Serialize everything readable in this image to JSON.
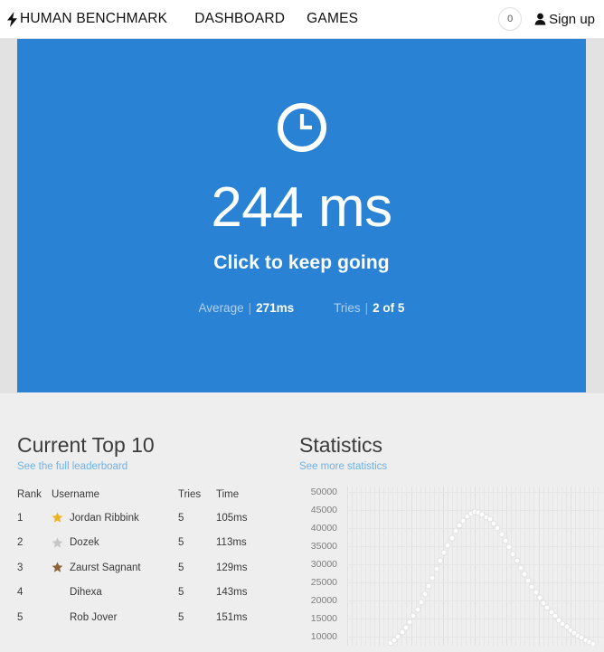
{
  "navbar": {
    "brand": "HUMAN BENCHMARK",
    "brand_icon": "bolt-icon",
    "links": [
      {
        "label": "DASHBOARD",
        "name": "nav-link-dashboard"
      },
      {
        "label": "GAMES",
        "name": "nav-link-games"
      }
    ],
    "token_count": "0",
    "signup_label": "Sign up",
    "signup_icon": "user-icon"
  },
  "test_panel": {
    "icon": "clock-icon",
    "time": "244 ms",
    "subtitle": "Click to keep going",
    "stats": [
      {
        "label": "Average",
        "separator": "|",
        "value": "271ms"
      },
      {
        "label": "Tries",
        "separator": "|",
        "value": "2 of 5"
      }
    ],
    "background_color": "#2a82d4"
  },
  "leaderboard": {
    "title": "Current Top 10",
    "link": "See the full leaderboard",
    "columns": [
      "Rank",
      "Username",
      "Tries",
      "Time"
    ],
    "rows": [
      {
        "rank": "1",
        "medal": "gold",
        "medal_color": "#e8b425",
        "username": "Jordan Ribbink",
        "tries": "5",
        "time": "105ms"
      },
      {
        "rank": "2",
        "medal": "silver",
        "medal_color": "#c6c6c6",
        "username": "Dozek",
        "tries": "5",
        "time": "113ms"
      },
      {
        "rank": "3",
        "medal": "bronze",
        "medal_color": "#8c6239",
        "username": "Zaurst Sagnant",
        "tries": "5",
        "time": "129ms"
      },
      {
        "rank": "4",
        "medal": "none",
        "medal_color": "",
        "username": "Dihexa",
        "tries": "5",
        "time": "143ms"
      },
      {
        "rank": "5",
        "medal": "none",
        "medal_color": "",
        "username": "Rob Jover",
        "tries": "5",
        "time": "151ms"
      }
    ]
  },
  "statistics": {
    "title": "Statistics",
    "link": "See more statistics"
  },
  "chart_data": {
    "type": "scatter",
    "title": "Statistics",
    "xlabel": "",
    "ylabel": "",
    "grid": true,
    "legend": null,
    "ylim": [
      7500,
      51500
    ],
    "yticks": [
      50000,
      45000,
      40000,
      35000,
      30000,
      25000,
      20000,
      15000,
      10000
    ],
    "ytick_labels": [
      "50000",
      "45000",
      "40000",
      "35000",
      "30000",
      "25000",
      "20000",
      "15000",
      "10000"
    ],
    "xlim": [
      0,
      100
    ],
    "note": "reaction-time distribution; counts of users per reaction time bucket",
    "points": [
      [
        17.0,
        8200
      ],
      [
        18.5,
        9000
      ],
      [
        20.0,
        10100
      ],
      [
        21.5,
        11300
      ],
      [
        23.0,
        12600
      ],
      [
        24.5,
        14100
      ],
      [
        26.0,
        15800
      ],
      [
        27.5,
        17600
      ],
      [
        29.0,
        19600
      ],
      [
        30.5,
        21700
      ],
      [
        32.0,
        24000
      ],
      [
        33.5,
        26300
      ],
      [
        35.0,
        28700
      ],
      [
        36.5,
        31000
      ],
      [
        38.0,
        33300
      ],
      [
        39.5,
        35400
      ],
      [
        41.0,
        37400
      ],
      [
        42.5,
        39200
      ],
      [
        44.0,
        40800
      ],
      [
        45.5,
        42100
      ],
      [
        47.0,
        43200
      ],
      [
        48.5,
        44000
      ],
      [
        50.0,
        44500
      ],
      [
        51.5,
        44400
      ],
      [
        53.0,
        43900
      ],
      [
        54.5,
        43100
      ],
      [
        56.0,
        42500
      ],
      [
        57.5,
        41400
      ],
      [
        59.0,
        40000
      ],
      [
        60.5,
        38400
      ],
      [
        62.0,
        36600
      ],
      [
        63.5,
        34800
      ],
      [
        65.0,
        32900
      ],
      [
        66.5,
        31000
      ],
      [
        68.0,
        29100
      ],
      [
        69.5,
        27300
      ],
      [
        71.0,
        25500
      ],
      [
        72.5,
        23800
      ],
      [
        74.0,
        22200
      ],
      [
        75.5,
        20700
      ],
      [
        77.0,
        19300
      ],
      [
        78.5,
        18000
      ],
      [
        80.0,
        16800
      ],
      [
        81.5,
        15700
      ],
      [
        83.0,
        14600
      ],
      [
        84.5,
        13600
      ],
      [
        86.0,
        12700
      ],
      [
        87.5,
        11900
      ],
      [
        89.0,
        11100
      ],
      [
        90.5,
        10400
      ],
      [
        92.0,
        9700
      ],
      [
        93.5,
        9100
      ],
      [
        95.0,
        8500
      ],
      [
        96.5,
        8000
      ]
    ]
  }
}
